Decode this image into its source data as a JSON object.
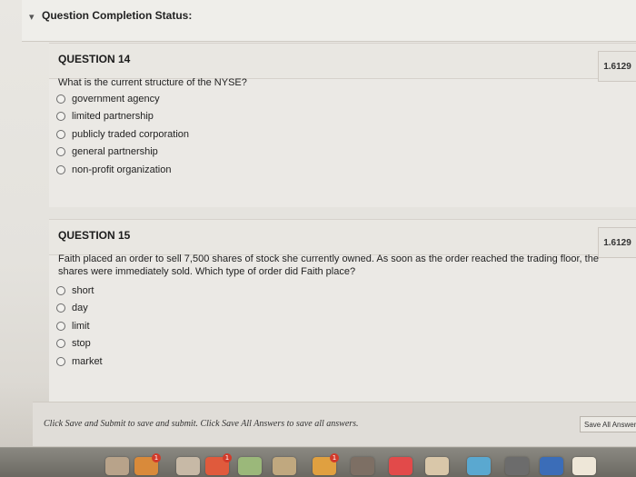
{
  "status": {
    "title": "Question Completion Status:",
    "caret_icon": "chevron-down-icon"
  },
  "questions": [
    {
      "title": "QUESTION 14",
      "points": "1.6129",
      "text": "What is the current structure of the NYSE?",
      "answers": [
        "government agency",
        "limited partnership",
        "publicly traded corporation",
        "general partnership",
        "non-profit organization"
      ]
    },
    {
      "title": "QUESTION 15",
      "points": "1.6129",
      "text": "Faith placed an order to sell 7,500 shares of stock she currently owned. As soon as the order reached the trading floor, the shares were immediately sold. Which type of order did Faith place?",
      "answers": [
        "short",
        "day",
        "limit",
        "stop",
        "market"
      ]
    }
  ],
  "submit": {
    "note": "Click Save and Submit to save and submit. Click Save All Answers to save all answers.",
    "save_all_label": "Save All Answers"
  },
  "dock": {
    "badges": [
      "1",
      "1",
      "1"
    ]
  },
  "colors": {
    "background": "#e9e7e2",
    "panel": "#ebe9e5",
    "dock": "#7a7870",
    "badge": "#d23a2a"
  }
}
